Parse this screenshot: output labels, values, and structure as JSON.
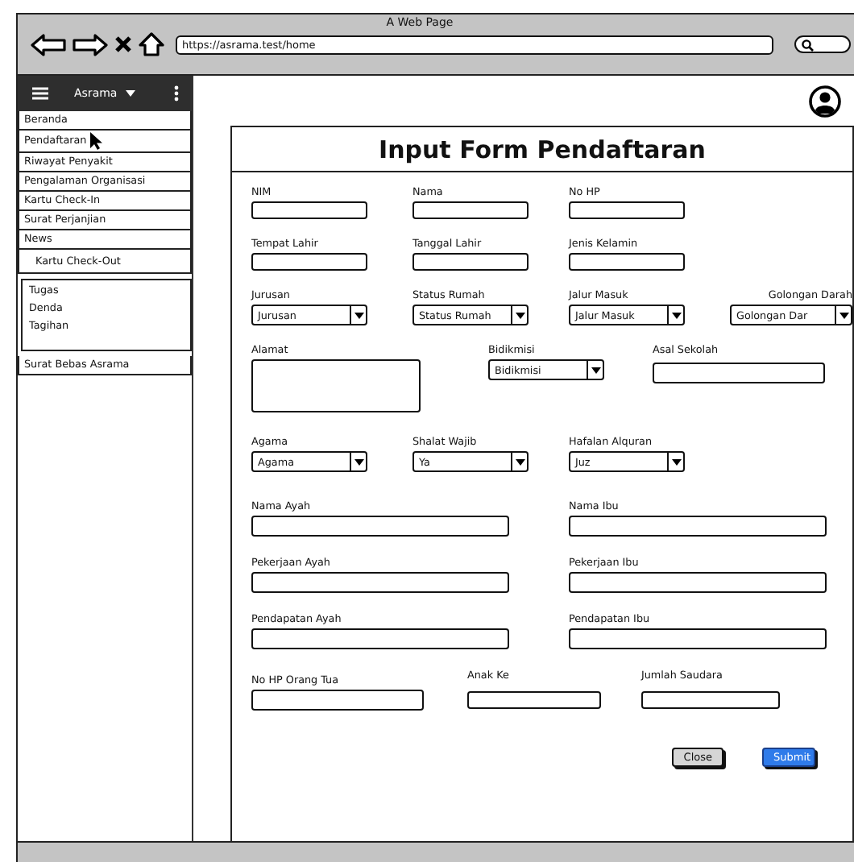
{
  "window": {
    "title": "A Web Page",
    "url": "https://asrama.test/home"
  },
  "sidebar": {
    "title": "Asrama",
    "items": [
      {
        "kind": "link",
        "label": "Beranda",
        "hovered": false
      },
      {
        "kind": "link",
        "label": "Pendaftaran",
        "hovered": true
      },
      {
        "kind": "link",
        "label": "Riwayat Penyakit",
        "hovered": false
      },
      {
        "kind": "link",
        "label": "Pengalaman Organisasi",
        "hovered": false
      },
      {
        "kind": "link",
        "label": "Kartu Check-In",
        "hovered": false
      },
      {
        "kind": "link",
        "label": "Surat Perjanjian",
        "hovered": false
      },
      {
        "kind": "link",
        "label": "News",
        "hovered": false,
        "children": [
          {
            "label": "Kartu Check-Out",
            "hovered": false
          }
        ]
      },
      {
        "kind": "group",
        "children": [
          {
            "label": "Tugas",
            "hovered": false
          },
          {
            "label": "Denda",
            "hovered": false
          },
          {
            "label": "Tagihan",
            "hovered": false
          }
        ]
      },
      {
        "kind": "link",
        "label": "Surat Bebas Asrama",
        "hovered": false
      }
    ]
  },
  "form": {
    "title": "Input Form Pendaftaran",
    "rows": [
      {
        "kind": "quad",
        "fields": [
          {
            "kind": "input",
            "label": "NIM"
          },
          {
            "kind": "input",
            "label": "Nama"
          },
          {
            "kind": "input",
            "label": "No HP"
          }
        ]
      },
      {
        "kind": "quad",
        "fields": [
          {
            "kind": "input",
            "label": "Tempat Lahir"
          },
          {
            "kind": "input",
            "label": "Tanggal Lahir"
          },
          {
            "kind": "input",
            "label": "Jenis Kelamin"
          }
        ]
      },
      {
        "kind": "quad",
        "fields": [
          {
            "kind": "select",
            "label": "Jurusan",
            "value": "Jurusan"
          },
          {
            "kind": "select",
            "label": "Status Rumah",
            "value": "Status Rumah"
          },
          {
            "kind": "select",
            "label": "Jalur Masuk",
            "value": "Jalur Masuk"
          },
          {
            "kind": "select",
            "label": "Golongan Darah",
            "value": "Golongan Dar"
          }
        ]
      },
      {
        "kind": "address",
        "fields": [
          {
            "kind": "textarea",
            "label": "Alamat"
          },
          {
            "kind": "select",
            "label": "Bidikmisi",
            "value": "Bidikmisi"
          },
          {
            "kind": "input",
            "label": "Asal Sekolah"
          }
        ]
      },
      {
        "kind": "quad",
        "fields": [
          {
            "kind": "select",
            "label": "Agama",
            "value": "Agama"
          },
          {
            "kind": "select",
            "label": "Shalat Wajib",
            "value": "Ya"
          },
          {
            "kind": "select",
            "label": "Hafalan Alquran",
            "value": "Juz"
          }
        ]
      },
      {
        "kind": "pair",
        "fields": [
          {
            "kind": "input",
            "label": "Nama Ayah"
          },
          {
            "kind": "input",
            "label": "Nama Ibu"
          }
        ]
      },
      {
        "kind": "pair",
        "fields": [
          {
            "kind": "input",
            "label": "Pekerjaan Ayah"
          },
          {
            "kind": "input",
            "label": "Pekerjaan Ibu"
          }
        ]
      },
      {
        "kind": "pair",
        "fields": [
          {
            "kind": "input",
            "label": "Pendapatan Ayah"
          },
          {
            "kind": "input",
            "label": "Pendapatan Ibu"
          }
        ]
      },
      {
        "kind": "trio",
        "fields": [
          {
            "kind": "input",
            "label": "No HP Orang Tua"
          },
          {
            "kind": "input",
            "label": "Anak Ke"
          },
          {
            "kind": "input",
            "label": "Jumlah Saudara"
          }
        ]
      }
    ],
    "buttons": [
      {
        "kind": "secondary",
        "label": "Close"
      },
      {
        "kind": "primary",
        "label": "Submit"
      }
    ]
  }
}
